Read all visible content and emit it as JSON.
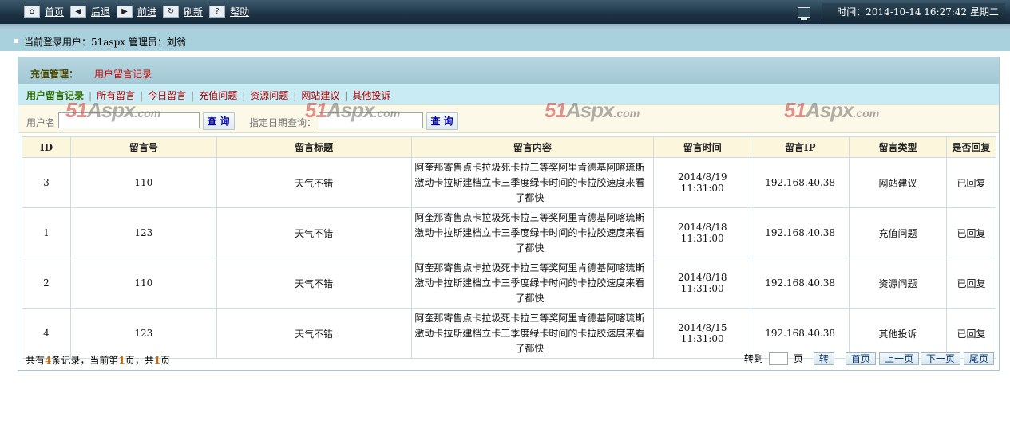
{
  "topbar": {
    "nav": [
      {
        "label": "首页",
        "icon": "home-icon",
        "glyph": "⌂"
      },
      {
        "label": "后退",
        "icon": "back-arrow-icon",
        "glyph": "◀"
      },
      {
        "label": "前进",
        "icon": "forward-arrow-icon",
        "glyph": "▶"
      },
      {
        "label": "刷新",
        "icon": "refresh-icon",
        "glyph": "↻"
      },
      {
        "label": "帮助",
        "icon": "help-icon",
        "glyph": "?"
      }
    ],
    "time_text": "时间：2014-10-14  16:27:42 星期二"
  },
  "userline": {
    "text": "当前登录用户：51aspx  管理员：刘翁"
  },
  "panel": {
    "title_label": "充值管理：",
    "title_value": "用户留言记录",
    "tabs": [
      "用户留言记录",
      "所有留言",
      "今日留言",
      "充值问题",
      "资源问题",
      "网站建议",
      "其他投诉"
    ],
    "active_tab": 0
  },
  "search": {
    "user_label": "用户名",
    "date_label": "指定日期查询：",
    "button_label": "查询",
    "user_value": "",
    "date_value": ""
  },
  "watermark": {
    "part1": "51",
    "part2": "Aspx",
    "part3": ".com"
  },
  "table": {
    "headers": [
      "ID",
      "留言号",
      "留言标题",
      "留言内容",
      "留言时间",
      "留言IP",
      "留言类型",
      "是否回复"
    ],
    "rows": [
      {
        "id": "3",
        "no": "110",
        "title": "天气不错",
        "content": "阿奎那寄售点卡拉圾死卡拉三等奖阿里肯德基阿喀琉斯激动卡拉斯建档立卡三季度绿卡时间的卡拉胶速度来看了都快",
        "time": "2014/8/19 11:31:00",
        "ip": "192.168.40.38",
        "type": "网站建议",
        "reply": "已回复"
      },
      {
        "id": "1",
        "no": "123",
        "title": "天气不错",
        "content": "阿奎那寄售点卡拉圾死卡拉三等奖阿里肯德基阿喀琉斯激动卡拉斯建档立卡三季度绿卡时间的卡拉胶速度来看了都快",
        "time": "2014/8/18 11:31:00",
        "ip": "192.168.40.38",
        "type": "充值问题",
        "reply": "已回复"
      },
      {
        "id": "2",
        "no": "110",
        "title": "天气不错",
        "content": "阿奎那寄售点卡拉圾死卡拉三等奖阿里肯德基阿喀琉斯激动卡拉斯建档立卡三季度绿卡时间的卡拉胶速度来看了都快",
        "time": "2014/8/18 11:31:00",
        "ip": "192.168.40.38",
        "type": "资源问题",
        "reply": "已回复"
      },
      {
        "id": "4",
        "no": "123",
        "title": "天气不错",
        "content": "阿奎那寄售点卡拉圾死卡拉三等奖阿里肯德基阿喀琉斯激动卡拉斯建档立卡三季度绿卡时间的卡拉胶速度来看了都快",
        "time": "2014/8/15 11:31:00",
        "ip": "192.168.40.38",
        "type": "其他投诉",
        "reply": "已回复"
      }
    ]
  },
  "footer": {
    "pre": "共有",
    "total": "4",
    "mid": "条记录，当前第",
    "current": "1",
    "mid2": "页，共",
    "pages": "1",
    "post": "页",
    "goto_label": "转到",
    "page_unit": "页",
    "go_button": "转",
    "first": "首页",
    "prev": "上一页",
    "next": "下一页",
    "last": "尾页"
  },
  "colors": {
    "topbar": "#1d3344",
    "userline": "#a9d0dd",
    "tabs_bg": "#c9ebf3",
    "red": "#cc0000",
    "green": "#1e7a1e"
  }
}
